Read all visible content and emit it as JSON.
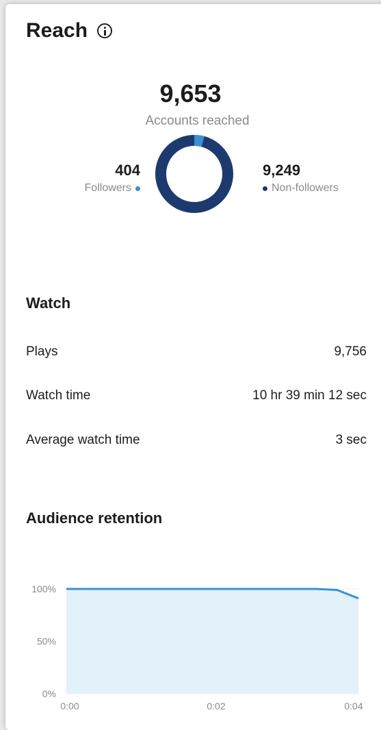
{
  "reach": {
    "title": "Reach",
    "total_value": "9,653",
    "total_label": "Accounts reached",
    "followers": {
      "value": "404",
      "label": "Followers",
      "color": "#3b8fd4"
    },
    "non_followers": {
      "value": "9,249",
      "label": "Non-followers",
      "color": "#1c3a6e"
    }
  },
  "watch": {
    "title": "Watch",
    "metrics": [
      {
        "label": "Plays",
        "value": "9,756"
      },
      {
        "label": "Watch time",
        "value": "10 hr 39 min 12 sec"
      },
      {
        "label": "Average watch time",
        "value": "3 sec"
      }
    ]
  },
  "retention": {
    "title": "Audience retention"
  },
  "chart_data": {
    "type": "area",
    "x": [
      0,
      0.5,
      1,
      1.5,
      2,
      2.5,
      3,
      3.5,
      3.8,
      4.1
    ],
    "x_tick_labels": [
      "0:00",
      "0:02",
      "0:04"
    ],
    "x_ticks": [
      0,
      2,
      4
    ],
    "y_tick_labels": [
      "100%",
      "50%",
      "0%"
    ],
    "y_ticks": [
      100,
      50,
      0
    ],
    "values": [
      100,
      100,
      100,
      100,
      100,
      100,
      100,
      100,
      99,
      91
    ],
    "ylim": [
      0,
      100
    ],
    "xlim": [
      0,
      4.1
    ],
    "line_color": "#3b8fd4",
    "fill_color": "#e3f1fb",
    "grid": true
  }
}
